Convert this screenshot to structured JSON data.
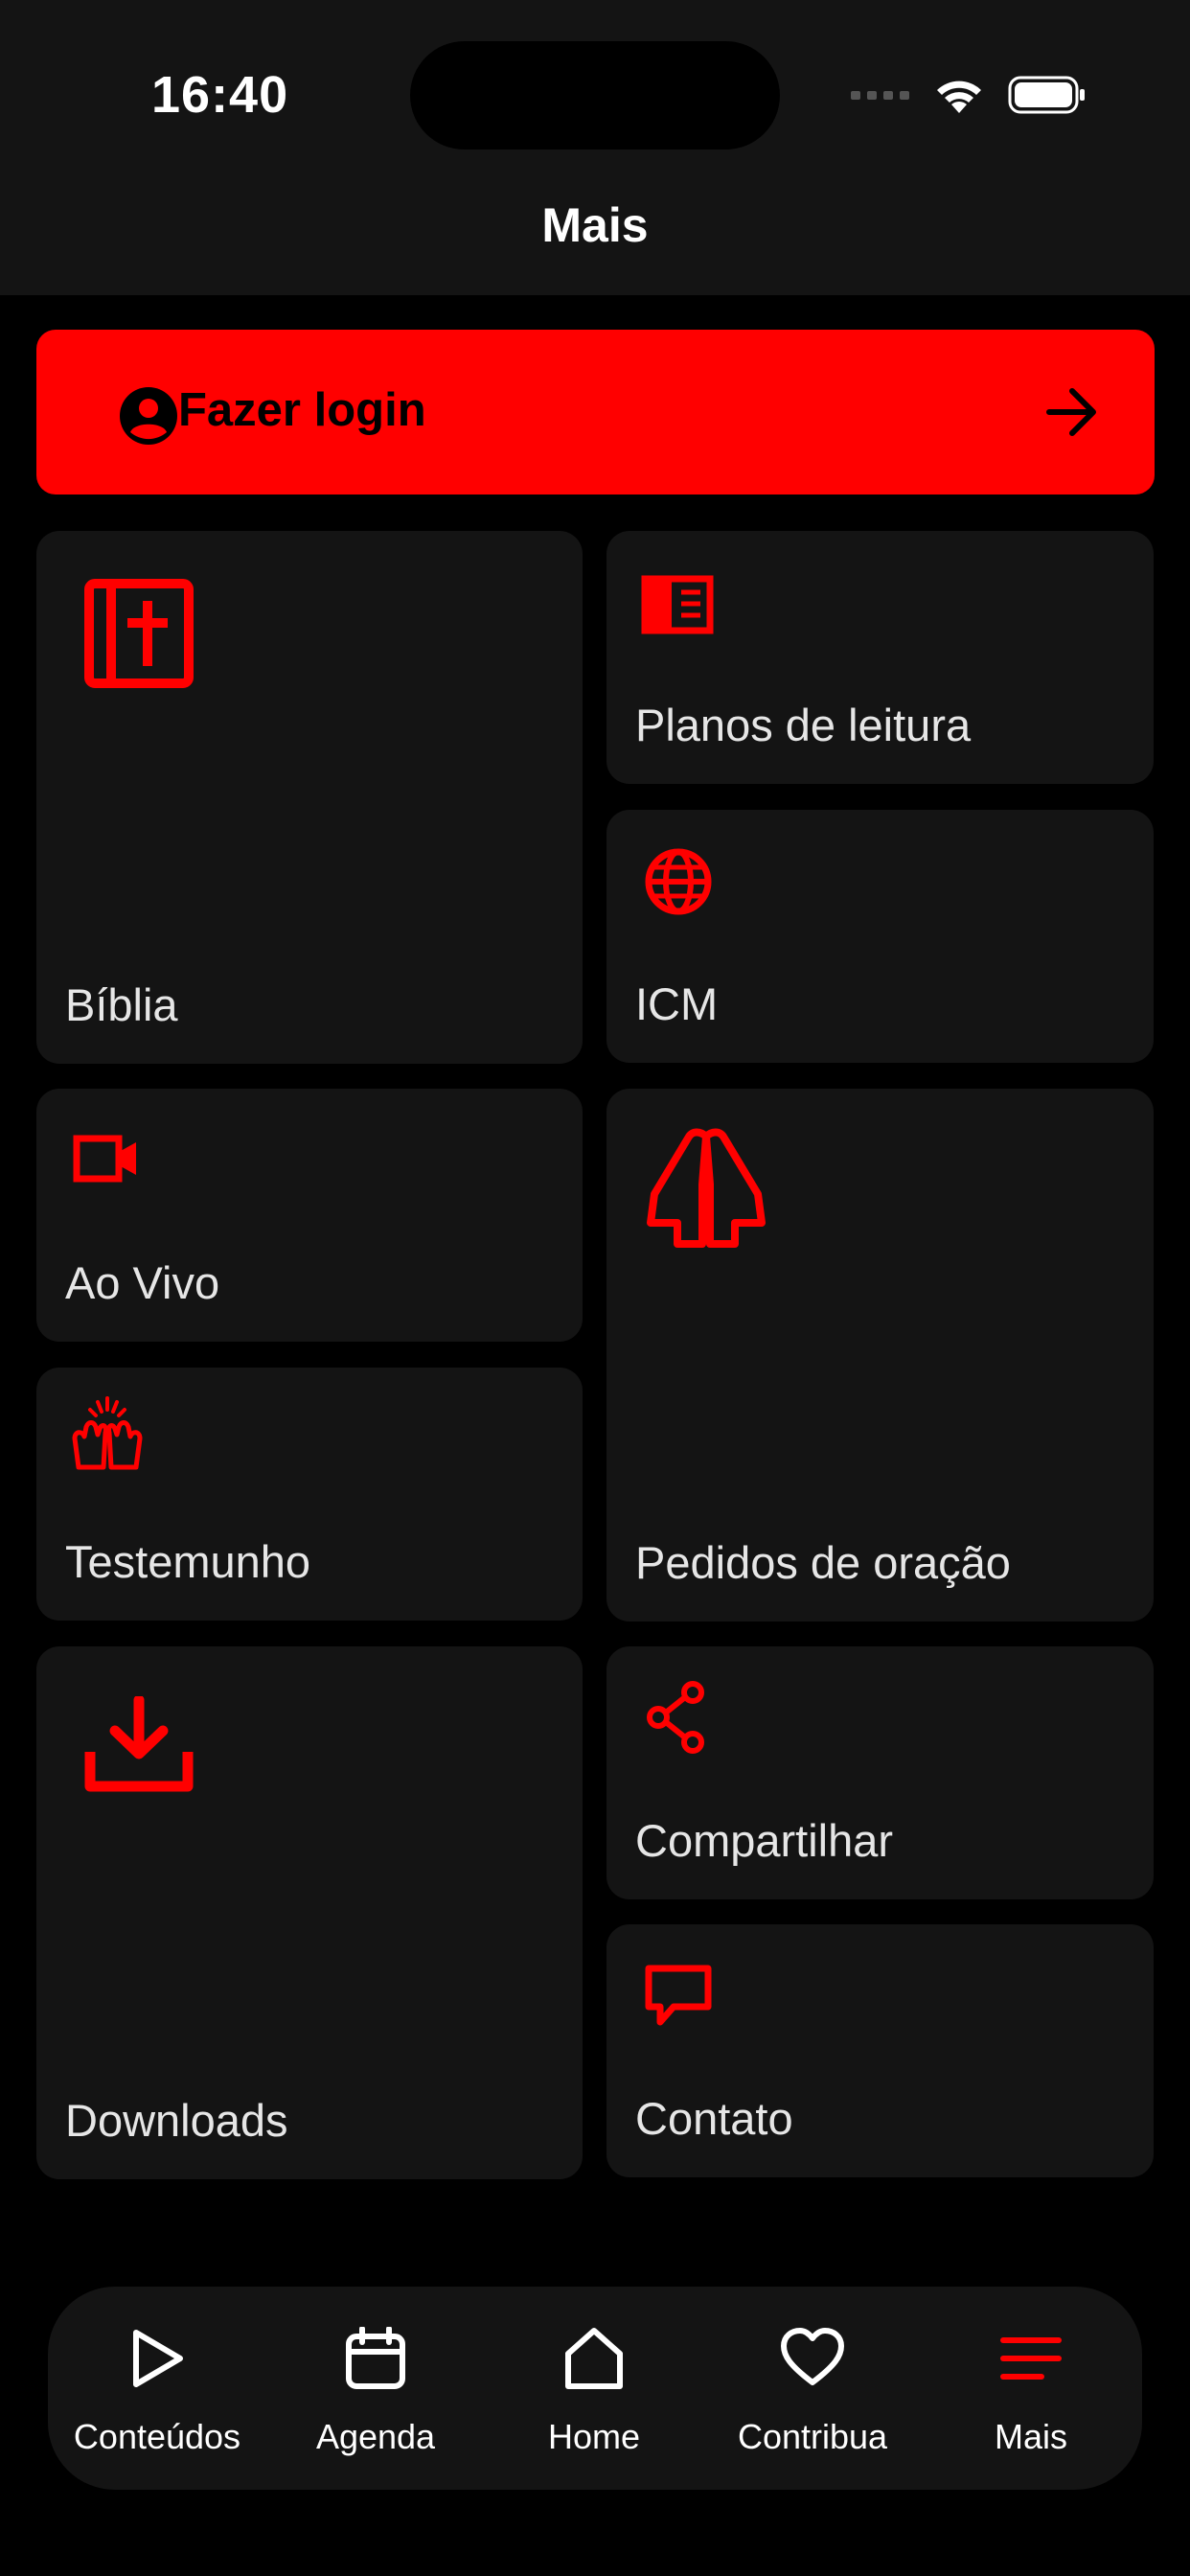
{
  "status_bar": {
    "time": "16:40"
  },
  "header": {
    "title": "Mais"
  },
  "login": {
    "label": "Fazer login"
  },
  "tiles": [
    {
      "label": "Bíblia",
      "icon": "bible-icon"
    },
    {
      "label": "Planos de leitura",
      "icon": "book-open-icon"
    },
    {
      "label": "ICM",
      "icon": "globe-icon"
    },
    {
      "label": "Ao Vivo",
      "icon": "video-camera-icon"
    },
    {
      "label": "Pedidos de oração",
      "icon": "praying-hands-icon"
    },
    {
      "label": "Testemunho",
      "icon": "raised-hands-icon"
    },
    {
      "label": "Downloads",
      "icon": "download-icon"
    },
    {
      "label": "Compartilhar",
      "icon": "share-icon"
    },
    {
      "label": "Contato",
      "icon": "chat-bubble-icon"
    }
  ],
  "nav": {
    "items": [
      {
        "label": "Conteúdos",
        "icon": "play-icon"
      },
      {
        "label": "Agenda",
        "icon": "calendar-icon"
      },
      {
        "label": "Home",
        "icon": "home-icon"
      },
      {
        "label": "Contribua",
        "icon": "heart-icon"
      },
      {
        "label": "Mais",
        "icon": "menu-icon"
      }
    ],
    "active": "Mais"
  },
  "colors": {
    "accent": "#ff0000",
    "surface": "#141414",
    "background": "#000000",
    "text": "#e6e6e6"
  }
}
